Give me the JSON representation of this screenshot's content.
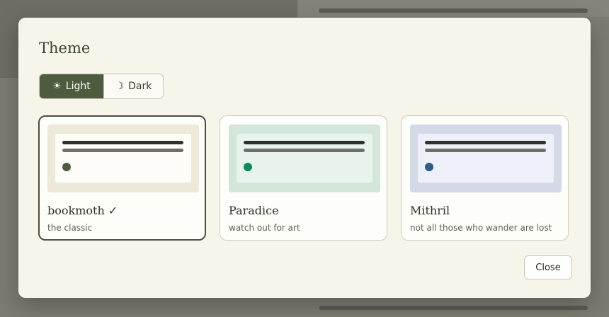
{
  "dialog": {
    "title": "Theme",
    "mode_toggle": {
      "light": {
        "icon": "sun-icon",
        "glyph": "☀",
        "label": "Light",
        "selected": true
      },
      "dark": {
        "icon": "moon-icon",
        "glyph": "☽",
        "label": "Dark",
        "selected": false
      }
    },
    "themes": [
      {
        "name": "bookmoth ✓",
        "description": "the classic",
        "selected": true,
        "preview_bg": "#ede8d8",
        "preview_inner": "#fdfcf8",
        "dot_color": "#4e5b3f"
      },
      {
        "name": "Paradice",
        "description": "watch out for art",
        "selected": false,
        "preview_bg": "#d3e6da",
        "preview_inner": "#e9f3ed",
        "dot_color": "#13875e"
      },
      {
        "name": "Mithril",
        "description": "not all those who wander are lost",
        "selected": false,
        "preview_bg": "#d3d9e7",
        "preview_inner": "#edf0f8",
        "dot_color": "#2f5d89"
      }
    ],
    "close_label": "Close"
  },
  "colors": {
    "accent": "#4e5b3f",
    "modal_bg": "#f7f5ea",
    "overlay": "#7d7a70"
  }
}
